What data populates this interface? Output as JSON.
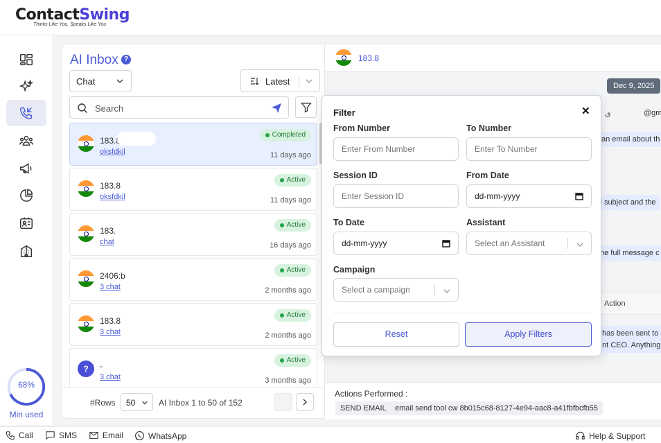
{
  "brand": {
    "name_part1": "Contact",
    "name_part2": "Swing",
    "tagline": "Thinks Like You, Speaks Like You",
    "accent": "#4b5bd6"
  },
  "usage": {
    "percent_label": "68%",
    "percent": 68,
    "caption": "Min used"
  },
  "inbox": {
    "title": "AI Inbox",
    "channel_select": "Chat",
    "sort_select": "Latest",
    "search_placeholder": "Search",
    "items": [
      {
        "number": "183.8",
        "sub": "oksfdkjl",
        "status": "Completed",
        "time": "11 days ago",
        "avatar": "flag"
      },
      {
        "number": "183.8",
        "sub": "oksfdkjl",
        "status": "Active",
        "time": "11 days ago",
        "avatar": "flag"
      },
      {
        "number": "183.",
        "sub": "chat",
        "status": "Active",
        "time": "16 days ago",
        "avatar": "flag"
      },
      {
        "number": "2406:b",
        "sub": "3 chat",
        "status": "Active",
        "time": "2 months ago",
        "avatar": "flag"
      },
      {
        "number": "183.8",
        "sub": "3 chat",
        "status": "Active",
        "time": "2 months ago",
        "avatar": "flag"
      },
      {
        "number": "-",
        "sub": "3 chat",
        "status": "Active",
        "time": "3 months ago",
        "avatar": "?"
      }
    ],
    "pager": {
      "rows_label": "#Rows",
      "rows_value": "50",
      "range": "AI Inbox 1 to 50 of 152"
    }
  },
  "conversation": {
    "number": "183.8",
    "date_chip": "Dec 9, 2025",
    "fragments": [
      "ی",
      "@gm",
      "an email about th",
      "il subject and the",
      "he full message c",
      "has been sent to",
      "nt CEO. Anything"
    ],
    "action_column": "Action",
    "actions_label": "Actions Performed :",
    "action_chips": [
      "SEND EMAIL",
      "email send tool cw 8b015c68-8127-4e94-aac8-a41fbfbcfb55"
    ]
  },
  "filter": {
    "title": "Filter",
    "close": "✕",
    "from_number": {
      "label": "From Number",
      "placeholder": "Enter From Number"
    },
    "to_number": {
      "label": "To Number",
      "placeholder": "Enter To Number"
    },
    "session_id": {
      "label": "Session ID",
      "placeholder": "Enter Session ID"
    },
    "from_date": {
      "label": "From Date",
      "value": "dd-mm-yyyy"
    },
    "to_date": {
      "label": "To Date",
      "value": "dd-mm-yyyy"
    },
    "assistant": {
      "label": "Assistant",
      "placeholder": "Select an Assistant"
    },
    "campaign": {
      "label": "Campaign",
      "placeholder": "Select a campaign"
    },
    "reset": "Reset",
    "apply": "Apply Filters"
  },
  "footer": {
    "call": "Call",
    "sms": "SMS",
    "email": "Email",
    "whatsapp": "WhatsApp",
    "help": "Help & Support"
  }
}
